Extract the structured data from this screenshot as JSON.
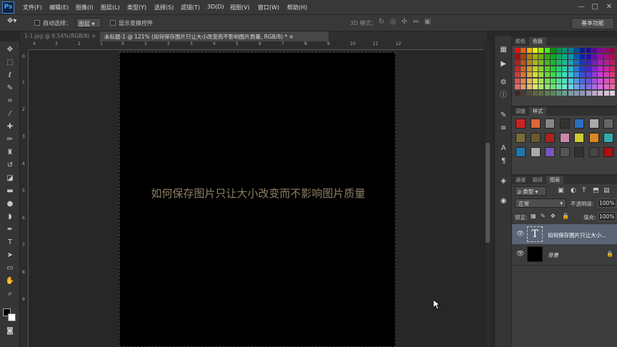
{
  "app": {
    "logo": "Ps"
  },
  "menu": [
    "文件(F)",
    "编辑(E)",
    "图像(I)",
    "图层(L)",
    "类型(Y)",
    "选择(S)",
    "滤镜(T)",
    "3D(D)",
    "视图(V)",
    "窗口(W)",
    "帮助(H)"
  ],
  "window_controls": {
    "minimize": "—",
    "maximize": "□",
    "close": "✕"
  },
  "options": {
    "auto_select_label": "自动选择：",
    "auto_select_value": "图层",
    "show_transform_label": "显示变换控件",
    "mode_3d_label": "3D 模式：",
    "workspace": "基本功能"
  },
  "tabs": [
    {
      "label": "1-1.jpg @ 8.54%(RGB/8)",
      "close": "×",
      "active": false
    },
    {
      "label": "未标题-1 @ 121% (如何保存图片只让大小改变而不影响图片质量, RGB/8) *",
      "close": "×",
      "active": true
    }
  ],
  "ruler_h": [
    "4",
    "3",
    "2",
    "1",
    "0",
    "1",
    "2",
    "3",
    "4",
    "5",
    "6",
    "7",
    "8",
    "9",
    "10",
    "11",
    "12"
  ],
  "ruler_v": [
    "0",
    "1",
    "2",
    "3",
    "4",
    "5",
    "6",
    "7",
    "8",
    "9"
  ],
  "canvas": {
    "text": "如何保存图片只让大小改变而不影响图片质量",
    "text_color": "#8d8064",
    "background": "#000000"
  },
  "panels": {
    "color_tabs": [
      "颜色",
      "色板"
    ],
    "adjust_tabs": [
      "调整",
      "样式"
    ],
    "layers_tabs": [
      "通道",
      "路径",
      "图层"
    ],
    "filter_label": "ρ 类型",
    "blend_mode": "正常",
    "opacity_label": "不透明度:",
    "opacity_value": "100%",
    "lock_label": "锁定:",
    "fill_label": "填充:",
    "fill_value": "100%"
  },
  "layers": [
    {
      "name": "如何保存图片只让大小...",
      "thumb": "T",
      "selected": true,
      "visible": true
    },
    {
      "name": "背景",
      "selected": false,
      "visible": true,
      "locked": true
    }
  ]
}
